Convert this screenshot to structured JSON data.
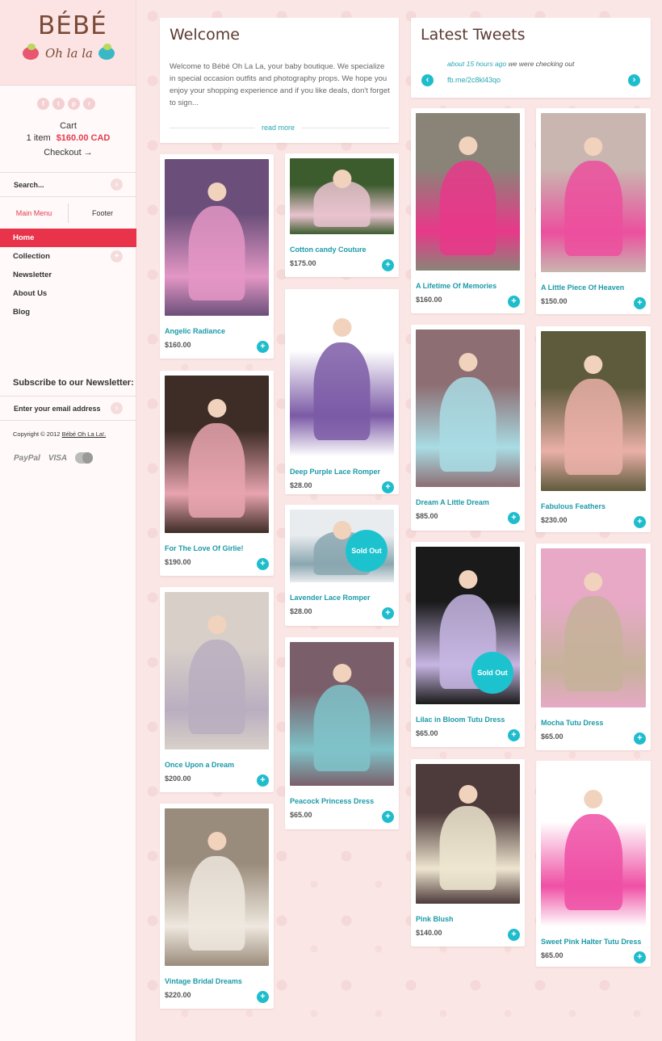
{
  "brand": {
    "name": "BÉBÉ",
    "tagline": "Oh la la"
  },
  "social": [
    "f",
    "t",
    "p",
    "r"
  ],
  "cart": {
    "title": "Cart",
    "items": "1 item",
    "total": "$160.00 CAD",
    "checkout": "Checkout →"
  },
  "search": {
    "placeholder": "Search..."
  },
  "menu_tabs": {
    "main": "Main Menu",
    "footer": "Footer"
  },
  "nav": [
    "Home",
    "Collection",
    "Newsletter",
    "About Us",
    "Blog"
  ],
  "newsletter": {
    "title": "Subscribe to our Newsletter:",
    "placeholder": "Enter your email address"
  },
  "footer": {
    "copyright": "Copyright © 2012",
    "owner": "Bébé Oh La La!."
  },
  "payments": {
    "paypal": "PayPal",
    "visa": "VISA"
  },
  "welcome": {
    "title": "Welcome",
    "text": "Welcome to Bébé Oh La La, your baby boutique. We specialize in special occasion outfits and photography props. We hope you enjoy your shopping experience and if you like deals, don't forget to sign...",
    "read_more": "read more"
  },
  "tweets": {
    "title": "Latest Tweets",
    "time": "about 15 hours ago",
    "text": "we were checking out",
    "link": "fb.me/2c8kl43qo"
  },
  "products": [
    {
      "name": "Angelic Radiance",
      "price": "$160.00",
      "colors": [
        "#6b4f7a",
        "#e497c6"
      ]
    },
    {
      "name": "For The Love Of Girlie!",
      "price": "$190.00",
      "colors": [
        "#3e2d26",
        "#e8a4b0"
      ]
    },
    {
      "name": "Once Upon a Dream",
      "price": "$200.00",
      "colors": [
        "#d8d0c8",
        "#b9aec0"
      ]
    },
    {
      "name": "Vintage Bridal Dreams",
      "price": "$220.00",
      "colors": [
        "#9a8c7c",
        "#efe8de"
      ]
    },
    {
      "name": "Cotton candy Couture",
      "price": "$175.00",
      "colors": [
        "#3c5c2e",
        "#e9c3cf"
      ]
    },
    {
      "name": "Deep Purple Lace Romper",
      "price": "$28.00",
      "colors": [
        "#ffffff",
        "#7b5aa6"
      ]
    },
    {
      "name": "Lavender Lace Romper",
      "price": "$28.00",
      "colors": [
        "#e9ecef",
        "#8aa7b0"
      ]
    },
    {
      "name": "Peacock Princess Dress",
      "price": "$65.00",
      "colors": [
        "#7a5f6a",
        "#7fc3c9"
      ]
    },
    {
      "name": "A Lifetime Of Memories",
      "price": "$160.00",
      "colors": [
        "#8a8478",
        "#e8388a"
      ]
    },
    {
      "name": "Dream A Little Dream",
      "price": "$85.00",
      "colors": [
        "#8d6e73",
        "#a9dce4"
      ]
    },
    {
      "name": "Lilac in Bloom Tutu Dress",
      "price": "$65.00",
      "colors": [
        "#1a1a1a",
        "#c7b6e3"
      ]
    },
    {
      "name": "Pink Blush",
      "price": "$140.00",
      "colors": [
        "#4d3a3a",
        "#efe6d0"
      ]
    },
    {
      "name": "A Little Piece Of Heaven",
      "price": "$150.00",
      "colors": [
        "#c9b6b0",
        "#ec4f9e"
      ]
    },
    {
      "name": "Fabulous Feathers",
      "price": "$230.00",
      "colors": [
        "#5e5b3c",
        "#eab0a8"
      ]
    },
    {
      "name": "Mocha Tutu Dress",
      "price": "$65.00",
      "colors": [
        "#e7a9c6",
        "#c5b29a"
      ]
    },
    {
      "name": "Sweet Pink Halter Tutu Dress",
      "price": "$65.00",
      "colors": [
        "#ffffff",
        "#ef4fa4"
      ]
    }
  ],
  "sold_out_label": "Sold Out"
}
